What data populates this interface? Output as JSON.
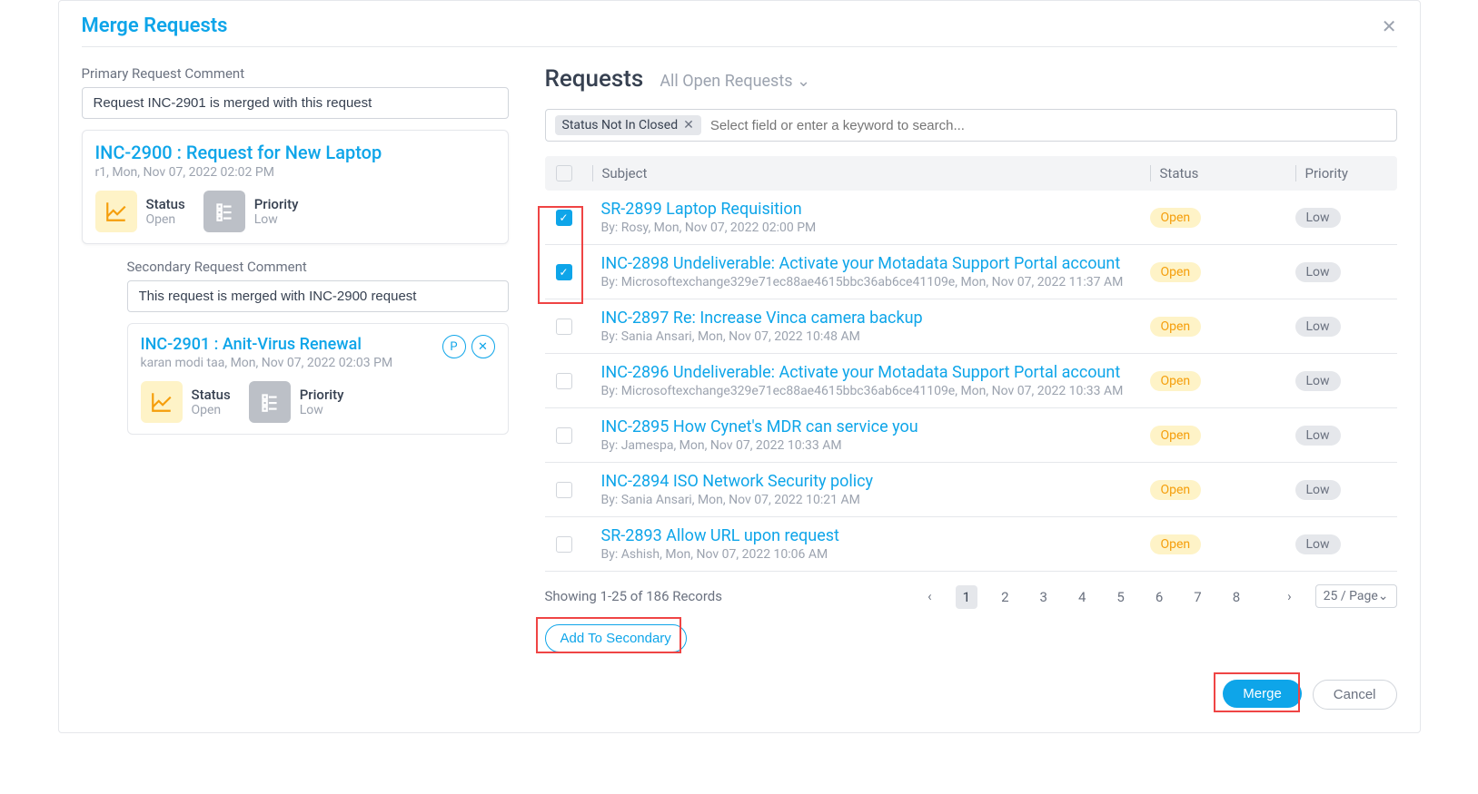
{
  "modal": {
    "title": "Merge Requests"
  },
  "primary": {
    "comment_label": "Primary Request Comment",
    "comment_value": "Request INC-2901 is merged with this request",
    "card": {
      "title": "INC-2900 : Request for New Laptop",
      "meta": "r1, Mon, Nov 07, 2022 02:02 PM",
      "status_label": "Status",
      "status_value": "Open",
      "priority_label": "Priority",
      "priority_value": "Low"
    }
  },
  "secondary": {
    "comment_label": "Secondary Request Comment",
    "comment_value": "This request is merged with INC-2900 request",
    "card": {
      "title": "INC-2901 : Anit-Virus Renewal",
      "meta": "karan modi taa, Mon, Nov 07, 2022 02:03 PM",
      "status_label": "Status",
      "status_value": "Open",
      "priority_label": "Priority",
      "priority_value": "Low"
    }
  },
  "requests": {
    "heading": "Requests",
    "filter": "All Open Requests",
    "chip": "Status Not In Closed",
    "search_placeholder": "Select field or enter a keyword to search...",
    "cols": {
      "subject": "Subject",
      "status": "Status",
      "priority": "Priority"
    },
    "rows": [
      {
        "checked": true,
        "title": "SR-2899 Laptop Requisition",
        "meta": "By: Rosy, Mon, Nov 07, 2022 02:00 PM",
        "status": "Open",
        "priority": "Low"
      },
      {
        "checked": true,
        "title": "INC-2898 Undeliverable: Activate your Motadata Support Portal account",
        "meta": "By: Microsoftexchange329e71ec88ae4615bbc36ab6ce41109e, Mon, Nov 07, 2022 11:37 AM",
        "status": "Open",
        "priority": "Low"
      },
      {
        "checked": false,
        "title": "INC-2897 Re: Increase Vinca camera backup",
        "meta": "By: Sania Ansari, Mon, Nov 07, 2022 10:48 AM",
        "status": "Open",
        "priority": "Low"
      },
      {
        "checked": false,
        "title": "INC-2896 Undeliverable: Activate your Motadata Support Portal account",
        "meta": "By: Microsoftexchange329e71ec88ae4615bbc36ab6ce41109e, Mon, Nov 07, 2022 10:33 AM",
        "status": "Open",
        "priority": "Low"
      },
      {
        "checked": false,
        "title": "INC-2895 How Cynet's MDR can service you",
        "meta": "By: Jamespa, Mon, Nov 07, 2022 10:33 AM",
        "status": "Open",
        "priority": "Low"
      },
      {
        "checked": false,
        "title": "INC-2894 ISO Network Security policy",
        "meta": "By: Sania Ansari, Mon, Nov 07, 2022 10:21 AM",
        "status": "Open",
        "priority": "Low"
      },
      {
        "checked": false,
        "title": "SR-2893 Allow URL upon request",
        "meta": "By: Ashish, Mon, Nov 07, 2022 10:06 AM",
        "status": "Open",
        "priority": "Low"
      }
    ]
  },
  "pagination": {
    "info": "Showing 1-25 of 186 Records",
    "pages": [
      "1",
      "2",
      "3",
      "4",
      "5",
      "6",
      "7",
      "8"
    ],
    "page_size": "25 / Page"
  },
  "buttons": {
    "add_secondary": "Add To Secondary",
    "merge": "Merge",
    "cancel": "Cancel"
  }
}
